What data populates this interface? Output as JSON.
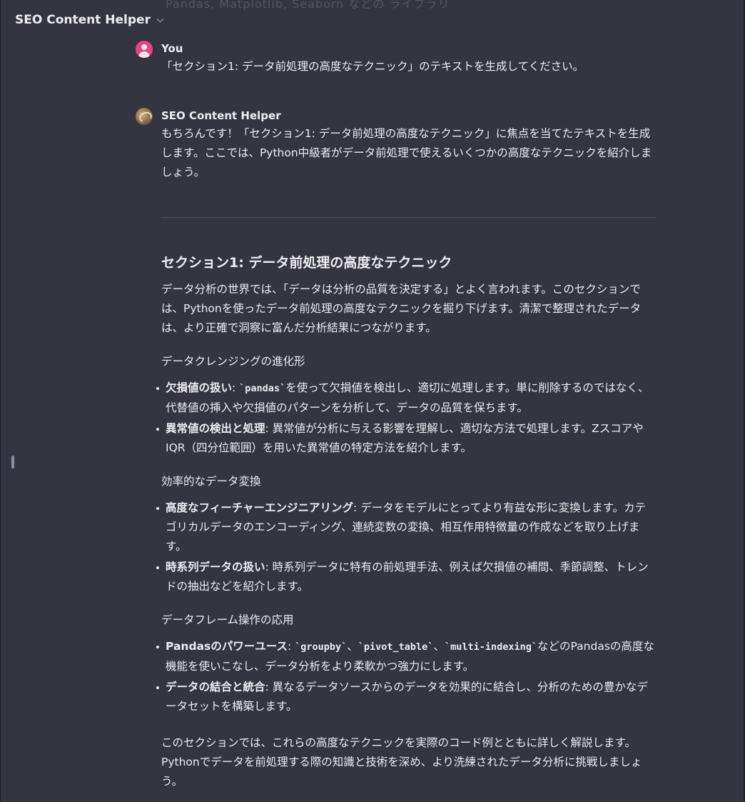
{
  "header": {
    "title": "SEO Content Helper"
  },
  "top_cut_text": "Pandas, Matplotlib, Seaborn などの ライブラリ",
  "conversation": {
    "user": {
      "author": "You",
      "text": "「セクション1: データ前処理の高度なテクニック」のテキストを生成してください。"
    },
    "assistant": {
      "author": "SEO Content Helper",
      "intro": "もちろんです！「セクション1: データ前処理の高度なテクニック」に焦点を当てたテキストを生成します。ここでは、Python中級者がデータ前処理で使えるいくつかの高度なテクニックを紹介しましょう。",
      "section_title": "セクション1: データ前処理の高度なテクニック",
      "section_intro": "データ分析の世界では、「データは分析の品質を決定する」とよく言われます。このセクションでは、Pythonを使ったデータ前処理の高度なテクニックを掘り下げます。清潔で整理されたデータは、より正確で洞察に富んだ分析結果につながります。",
      "subsections": [
        {
          "title": "データクレンジングの進化形",
          "items": [
            {
              "label": "欠損値の扱い",
              "sep": ": ",
              "code": "`pandas`",
              "text": "を使って欠損値を検出し、適切に処理します。単に削除するのではなく、代替値の挿入や欠損値のパターンを分析して、データの品質を保ちます。"
            },
            {
              "label": "異常値の検出と処理",
              "sep": ": ",
              "text": "異常値が分析に与える影響を理解し、適切な方法で処理します。ZスコアやIQR（四分位範囲）を用いた異常値の特定方法を紹介します。"
            }
          ]
        },
        {
          "title": "効率的なデータ変換",
          "items": [
            {
              "label": "高度なフィーチャーエンジニアリング",
              "sep": ": ",
              "text": "データをモデルにとってより有益な形に変換します。カテゴリカルデータのエンコーディング、連続変数の変換、相互作用特徴量の作成などを取り上げます。"
            },
            {
              "label": "時系列データの扱い",
              "sep": ": ",
              "text": "時系列データに特有の前処理手法、例えば欠損値の補間、季節調整、トレンドの抽出などを紹介します。"
            }
          ]
        },
        {
          "title": "データフレーム操作の応用",
          "items": [
            {
              "label": "Pandasのパワーユース",
              "sep": ": ",
              "code1": "`groupby`",
              "sep1": "、",
              "code2": "`pivot_table`",
              "sep2": "、",
              "code3": "`multi-indexing`",
              "text": "などのPandasの高度な機能を使いこなし、データ分析をより柔軟かつ強力にします。"
            },
            {
              "label": "データの結合と統合",
              "sep": ": ",
              "text": "異なるデータソースからのデータを効果的に結合し、分析のための豊かなデータセットを構築します。"
            }
          ]
        }
      ],
      "closing": "このセクションでは、これらの高度なテクニックを実際のコード例とともに詳しく解説します。Pythonでデータを前処理する際の知識と技術を深め、より洗練されたデータ分析に挑戦しましょう。"
    }
  },
  "colors": {
    "background": "#343541",
    "text": "#ececf1",
    "user_avatar": "#e0487f"
  }
}
